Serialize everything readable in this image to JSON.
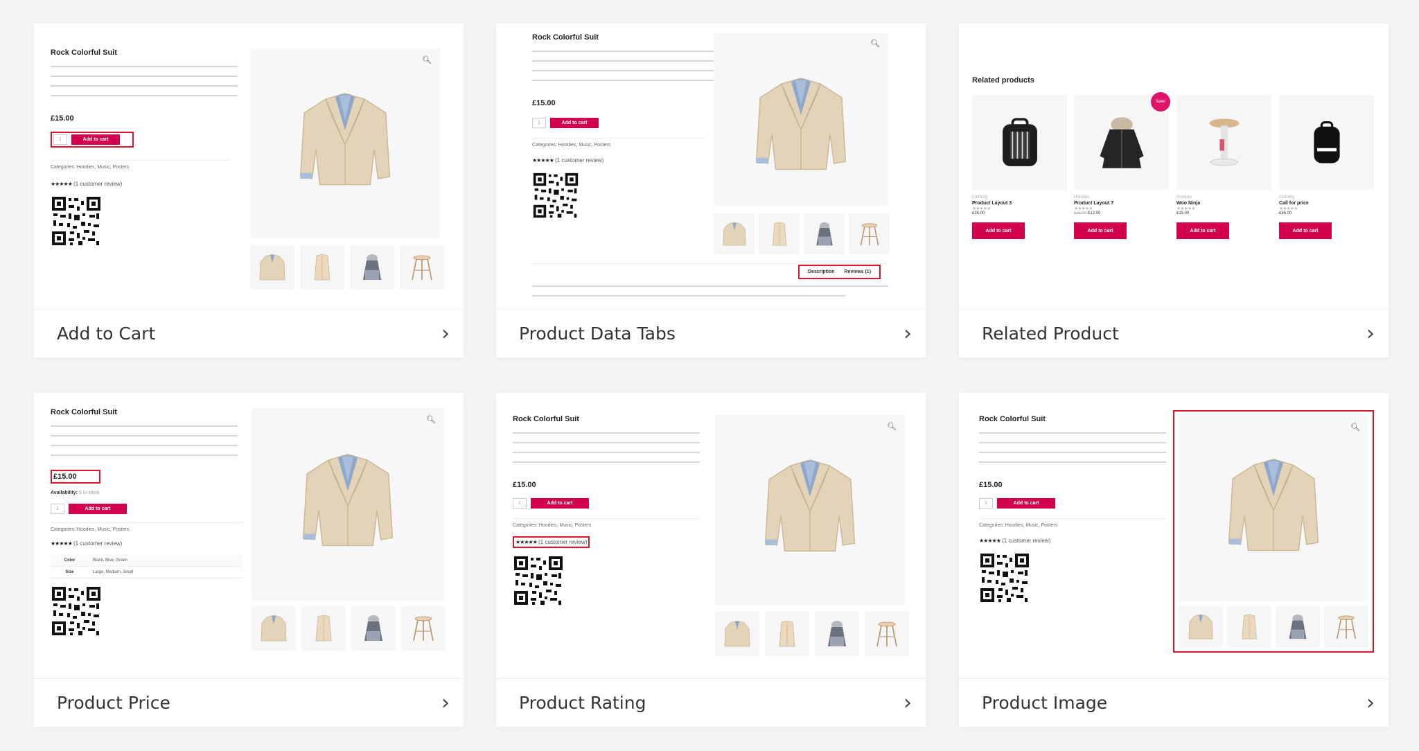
{
  "product": {
    "title": "Rock Colorful Suit",
    "price": "£15.00",
    "qty": "1",
    "add_to_cart": "Add to cart",
    "categories": "Categories: Hoodies, Music, Posters",
    "review": "(1 customer review)",
    "stars": "★★★★★",
    "availability_label": "Availability:",
    "availability_value": "5 in stock",
    "attributes": [
      {
        "name": "Color",
        "value": "Black, Blue, Green"
      },
      {
        "name": "Size",
        "value": "Large, Medium, Small"
      }
    ]
  },
  "tabs": {
    "description": "Description",
    "reviews": "Reviews (1)"
  },
  "related": {
    "title": "Related products",
    "sale_badge": "Sale!",
    "items": [
      {
        "category": "Clothing",
        "name": "Product Layout 3",
        "old_price": "",
        "price": "£35.00",
        "button": "Add to cart"
      },
      {
        "category": "Hoodies",
        "name": "Product Layout 7",
        "old_price": "£15.00",
        "price": "£12.00",
        "button": "Add to cart"
      },
      {
        "category": "Hoodies",
        "name": "Woo Ninja",
        "old_price": "",
        "price": "£15.00",
        "button": "Add to cart"
      },
      {
        "category": "Clothing",
        "name": "Call for price",
        "old_price": "",
        "price": "£35.00",
        "button": "Add to cart"
      }
    ]
  },
  "cards": [
    {
      "title": "Add to Cart"
    },
    {
      "title": "Product Data Tabs"
    },
    {
      "title": "Related Product"
    },
    {
      "title": "Product Price"
    },
    {
      "title": "Product Rating"
    },
    {
      "title": "Product Image"
    }
  ],
  "colors": {
    "accent": "#d3014c",
    "highlight": "#e0142d",
    "background": "#f6f5f5"
  },
  "icons": {
    "zoom": "magnifier-icon",
    "arrow": "chevron-right-icon"
  }
}
